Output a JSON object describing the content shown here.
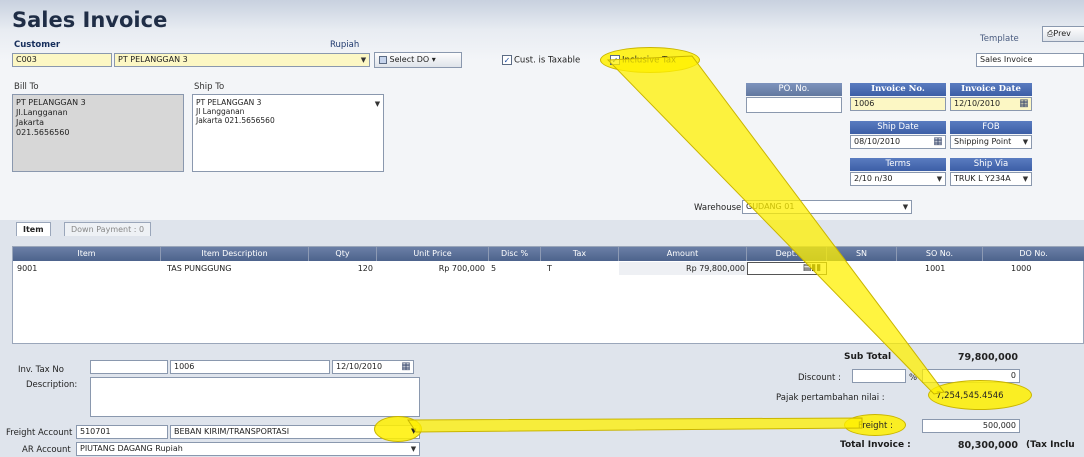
{
  "title": "Sales Invoice",
  "header": {
    "customer_label": "Customer",
    "customer_code": "C003",
    "customer_name": "PT PELANGGAN 3",
    "currency_label": "Rupiah",
    "select_do_label": "Select DO",
    "cust_taxable_label": "Cust. is Taxable",
    "inclusive_tax_label": "Inclusive Tax",
    "template_label": "Template",
    "preview_label": "Prev",
    "template_value": "Sales Invoice"
  },
  "bill_to": {
    "label": "Bill To",
    "lines": [
      "PT PELANGGAN 3",
      "Jl.Langganan",
      "Jakarta",
      "021.5656560"
    ]
  },
  "ship_to": {
    "label": "Ship To",
    "lines": [
      "PT PELANGGAN 3",
      "Jl Langganan",
      "Jakarta  021.5656560"
    ]
  },
  "invoice_info": {
    "po_label": "PO. No.",
    "po_value": "",
    "invoice_no_label": "Invoice No.",
    "invoice_no": "1006",
    "invoice_date_label": "Invoice Date",
    "invoice_date": "12/10/2010",
    "ship_date_label": "Ship Date",
    "ship_date": "08/10/2010",
    "fob_label": "FOB",
    "fob_value": "Shipping Point",
    "terms_label": "Terms",
    "terms_value": "2/10 n/30",
    "ship_via_label": "Ship Via",
    "ship_via_value": "TRUK L Y234A",
    "warehouse_label": "Warehouse",
    "warehouse_value": "GUDANG 01"
  },
  "tabs": [
    {
      "label": "Item"
    },
    {
      "label": "Down Payment : 0"
    }
  ],
  "grid": {
    "columns": [
      "Item",
      "Item Description",
      "Qty",
      "Unit Price",
      "Disc %",
      "Tax",
      "Amount",
      "Dept.",
      "SN",
      "SO No.",
      "DO No."
    ],
    "rows": [
      {
        "item": "9001",
        "description": "TAS PUNGGUNG",
        "qty": "120",
        "unit_price": "Rp 700,000",
        "disc": "5",
        "tax": "T",
        "amount": "Rp 79,800,000",
        "dept": "",
        "sn": "",
        "so": "1001",
        "do": "1000"
      }
    ]
  },
  "footer": {
    "inv_tax_label": "Inv. Tax No",
    "inv_tax_no": "1006",
    "inv_tax_date": "12/10/2010",
    "description_label": "Description:",
    "description_value": "",
    "freight_account_label": "Freight Account",
    "freight_account_code": "510701",
    "freight_account_name": "BEBAN KIRIM/TRANSPORTASI",
    "ar_account_label": "AR Account",
    "ar_account_value": "PIUTANG DAGANG  Rupiah"
  },
  "totals": {
    "subtotal_label": "Sub Total",
    "subtotal_value": "79,800,000",
    "discount_label": "Discount :",
    "discount_value": "0",
    "percent_sign": "%",
    "ppn_label": "Pajak pertambahan nilai :",
    "ppn_value": "7,254,545.4546",
    "freight_label": "Freight :",
    "freight_value": "500,000",
    "total_label": "Total Invoice :",
    "total_value": "80,300,000",
    "total_suffix": "(Tax Inclu"
  },
  "colors": {
    "highlight": "#fff000",
    "header_blue": "#3c5ea6"
  }
}
